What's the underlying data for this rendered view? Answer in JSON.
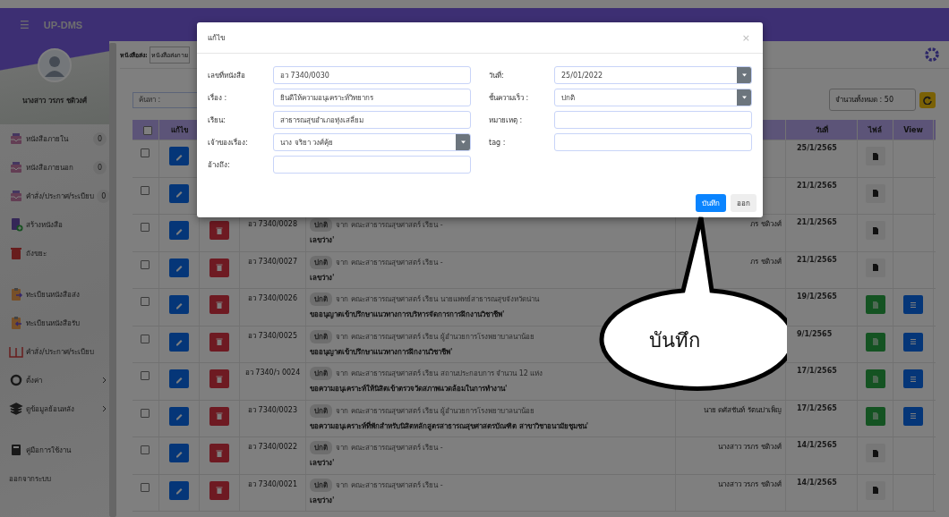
{
  "app": {
    "title": "UP-DMS",
    "menu_icon": "☰"
  },
  "profile": {
    "name": "นางสาว วรภร ชดิวงศ์"
  },
  "sidebar": {
    "sections": [
      {
        "items": [
          {
            "label": "หนังสือภายใน",
            "kind": "inbox",
            "count": "0",
            "submenu": false
          },
          {
            "label": "หนังสือภายนอก",
            "kind": "inbox",
            "count": "0",
            "submenu": false
          },
          {
            "label": "คำสั่ง/ประกาศ/ระเบียบ",
            "kind": "inbox",
            "count": "0",
            "submenu": false
          },
          {
            "label": "สร้างหนังสือ",
            "kind": "create",
            "submenu": false
          },
          {
            "label": "ถังขยะ",
            "kind": "trash",
            "submenu": false
          }
        ]
      },
      {
        "items": [
          {
            "label": "ทะเบียนหนังสือส่ง",
            "kind": "outgoing",
            "submenu": false
          },
          {
            "label": "ทะเบียนหนังสือรับ",
            "kind": "incoming",
            "submenu": false
          },
          {
            "label": "คำสั่ง/ประกาศ/ระเบียบ",
            "kind": "book",
            "submenu": false
          },
          {
            "label": "ตั้งค่า",
            "kind": "settings",
            "submenu": true
          },
          {
            "label": "ดูข้อมูลย้อนหลัง",
            "kind": "layers",
            "submenu": true
          }
        ]
      },
      {
        "items": [
          {
            "label": "คู่มือการใช้งาน",
            "kind": "manual",
            "submenu": false
          },
          {
            "label": "ออกจากระบบ",
            "kind": "logout",
            "submenu": false
          }
        ]
      }
    ]
  },
  "filter": {
    "label": "หนังสือส่ง:",
    "value": "หนังสือส่งภาย"
  },
  "search": {
    "placeholder": "ค้นหา :"
  },
  "page_size": {
    "value": "จำนวนทั้งหมด : 50"
  },
  "table": {
    "header_checked": false,
    "columns": [
      "แก้ไข",
      "วันที่",
      "ไฟล์",
      "View"
    ],
    "rows": [
      {
        "checked": false,
        "date": "25/1/2565",
        "file": {
          "kind": "plain"
        },
        "view": false
      },
      {
        "checked": false,
        "date": "21/1/2565",
        "file": {
          "kind": "plain"
        },
        "view": false
      },
      {
        "checked": false,
        "number": "อว 7340/0028",
        "priority": "ปกติ",
        "from": "จาก คณะสาธารณสุขศาสตร์ เรียน -",
        "subject": "เลขว่าง'",
        "owner": "ภร ชดิวงศ์",
        "date": "21/1/2565",
        "file": {
          "kind": "plain"
        },
        "view": false
      },
      {
        "checked": false,
        "number": "อว 7340/0027",
        "priority": "ปกติ",
        "from": "จาก คณะสาธารณสุขศาสตร์ เรียน -",
        "subject": "เลขว่าง'",
        "owner": "ภร ชดิวงศ์",
        "date": "21/1/2565",
        "file": {
          "kind": "plain"
        },
        "view": false
      },
      {
        "checked": false,
        "number": "อว 7340/0026",
        "priority": "ปกติ",
        "from": "จาก คณะสาธารณสุขศาสตร์ เรียน นายแพทย์สาธารณสุขจังหวัดน่าน",
        "subject": "ขออนุญาตเข้าปรึกษาแนวทางการบริหารจัดการการฝึกงานวิชาชีพ'",
        "date": "19/1/2565",
        "file": {
          "kind": "pdf"
        },
        "view": true
      },
      {
        "checked": false,
        "number": "อว 7340/0025",
        "priority": "ปกติ",
        "from": "จาก คณะสาธารณสุขศาสตร์ เรียน ผู้อำนวยการโรงพยาบาลนาน้อย",
        "subject": "ขออนุญาตเข้าปรึกษาแนวทางการฝึกงานวิชาชีพ'",
        "date": "9/1/2565",
        "file": {
          "kind": "pdf"
        },
        "view": true
      },
      {
        "checked": false,
        "number": "อว 7340/ว 0024",
        "priority": "ปกติ",
        "from": "จาก คณะสาธารณสุขศาสตร์ เรียน สถานประกอบการ จำนวน 12 แห่ง",
        "subject": "ขอความอนุเคราะห์ให้นิสิตเข้าตรวจวัดสภาพแวดล้อมในการทำงาน'",
        "date": "17/1/2565",
        "file": {
          "kind": "pdf"
        },
        "view": true
      },
      {
        "checked": false,
        "number": "อว 7340/0023",
        "priority": "ปกติ",
        "from": "จาก คณะสาธารณสุขศาสตร์ เรียน ผู้อำนวยการโรงพยาบาลนาน้อย",
        "subject": "ขอความอนุเคราะห์ที่พักสำหรับนิสิตหลักสูตรสาธารณสุขศาสตรบัณฑิต สาขาวิชาอนามัยชุมชน'",
        "owner": "นาย ดศัสชันท์ รัตนปาเพ็ญ",
        "date": "17/1/2565",
        "file": {
          "kind": "pdf"
        },
        "view": true
      },
      {
        "checked": false,
        "number": "อว 7340/0022",
        "priority": "ปกติ",
        "from": "จาก คณะสาธารณสุขศาสตร์ เรียน -",
        "subject": "เลขว่าง'",
        "owner": "นางสาว วรภร ชดิวงศ์",
        "date": "14/1/2565",
        "file": {
          "kind": "plain"
        },
        "view": false
      },
      {
        "checked": false,
        "number": "อว 7340/0021",
        "priority": "ปกติ",
        "from": "จาก คณะสาธารณสุขศาสตร์ เรียน -",
        "subject": "เลขว่าง'",
        "owner": "นางสาว วรภร ชดิวงศ์",
        "date": "14/1/2565",
        "file": {
          "kind": "plain"
        },
        "view": false
      }
    ]
  },
  "modal": {
    "title": "แก้ไข",
    "close": "×",
    "left": [
      {
        "label": "เลขที่หนังสือ",
        "kind": "text",
        "value": "อว 7340/0030"
      },
      {
        "label": "เรื่อง :",
        "kind": "text",
        "value": "ยินดีให้ความอนุเคราะห์วิทยากร"
      },
      {
        "label": "เรียน:",
        "kind": "text",
        "value": "สาธารณสุขอำเภอทุ่งเสลี่ยม"
      },
      {
        "label": "เจ้าของเรื่อง:",
        "kind": "select",
        "value": "นาง จริยา วงศ์คุ้ย"
      },
      {
        "label": "อ้างถึง:",
        "kind": "text"
      }
    ],
    "right": [
      {
        "label": "วันที่:",
        "kind": "select",
        "value": "25/01/2022"
      },
      {
        "label": "ชั้นความเร็ว :",
        "kind": "select",
        "value": "ปกติ"
      },
      {
        "label": "หมายเหตุ :",
        "kind": "text"
      },
      {
        "label": "tag :",
        "kind": "text"
      }
    ],
    "buttons": [
      {
        "label": "บันทึก",
        "kind": "primary"
      },
      {
        "label": "ออก",
        "kind": "secondary"
      }
    ]
  },
  "callout": {
    "text": "บันทึก"
  }
}
